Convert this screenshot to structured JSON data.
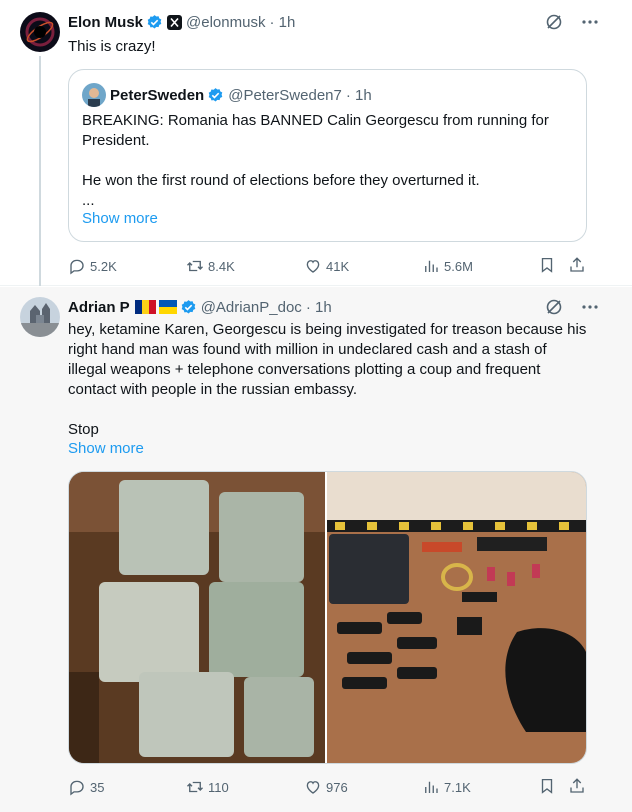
{
  "tweets": [
    {
      "author_name": "Elon Musk",
      "handle": "@elonmusk",
      "sep_time": "· 1h",
      "text": "This is crazy!",
      "quote": {
        "author_name": "PeterSweden",
        "handle": "@PeterSweden7",
        "sep_time": "· 1h",
        "text": "BREAKING: Romania has BANNED Calin Georgescu from running for President.\n\nHe won the first round of elections before they overturned it.\n...",
        "show_more": "Show more"
      },
      "stats": {
        "replies": "5.2K",
        "reposts": "8.4K",
        "likes": "41K",
        "views": "5.6M"
      }
    },
    {
      "author_name": "Adrian P",
      "handle": "@AdrianP_doc",
      "sep_time": "· 1h",
      "text": "hey, ketamine Karen, Georgescu is being investigated for treason because his right hand man was found with million in undeclared cash and a stash of illegal weapons + telephone conversations plotting a coup and frequent contact with people in the russian embassy.\n\nStop",
      "show_more": "Show more",
      "stats": {
        "replies": "35",
        "reposts": "110",
        "likes": "976",
        "views": "7.1K"
      }
    }
  ],
  "colors": {
    "verified": "#1d9bf0",
    "link": "#1d9bf0",
    "muted": "#536471",
    "text": "#0f1419"
  },
  "icons": [
    "grok-icon",
    "more-icon",
    "reply-icon",
    "repost-icon",
    "like-icon",
    "views-icon",
    "bookmark-icon",
    "share-icon",
    "verified-badge-icon",
    "x-affiliate-icon"
  ]
}
